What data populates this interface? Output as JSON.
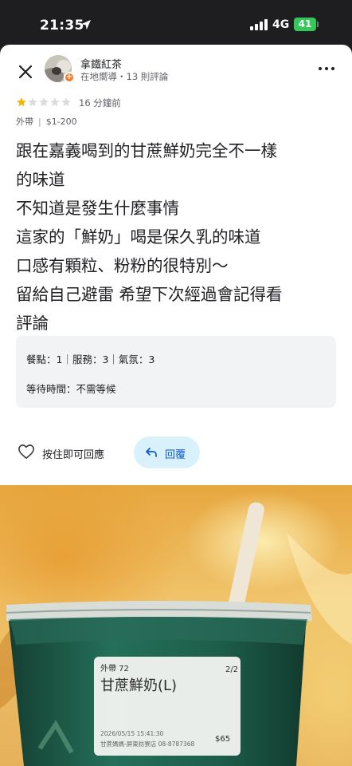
{
  "status_bar": {
    "time": "21:35",
    "network": "4G",
    "battery": "41"
  },
  "reviewer": {
    "name": "拿鐵紅茶",
    "meta": "在地嚮導・13 則評論"
  },
  "review": {
    "rating": 1,
    "max_rating": 5,
    "time_ago": "16 分鐘前",
    "tags": [
      "外帶",
      "$1-200"
    ],
    "text_lines": [
      "跟在嘉義喝到的甘蔗鮮奶完全不一樣",
      "的味道",
      "不知道是發生什麼事情",
      "這家的「鮮奶」喝是保久乳的味道",
      "口感有顆粒、粉粉的很特別～",
      "留給自己避雷 希望下次經過會記得看",
      "評論"
    ],
    "sub_ratings": "餐點：1｜服務：3｜氣氛：3",
    "wait_time": "等待時間：不需等候"
  },
  "actions": {
    "like_label": "按住即可回應",
    "reply_label": "回覆"
  },
  "photo": {
    "label_line1": "外帶 72",
    "label_page": "2/2",
    "product": "甘蔗鮮奶(L)",
    "label_datetime": "2026/05/15 15:41:30",
    "label_price": "$65",
    "label_store": "甘蔗媽媽-屏東枋寮店 08-8787368"
  },
  "colors": {
    "star_filled": "#f4b400",
    "star_empty": "#dadce0",
    "reply_bg": "#d8f1fb",
    "reply_text": "#0b57d0",
    "battery": "#34c759",
    "cup": "#1f5f4a"
  }
}
